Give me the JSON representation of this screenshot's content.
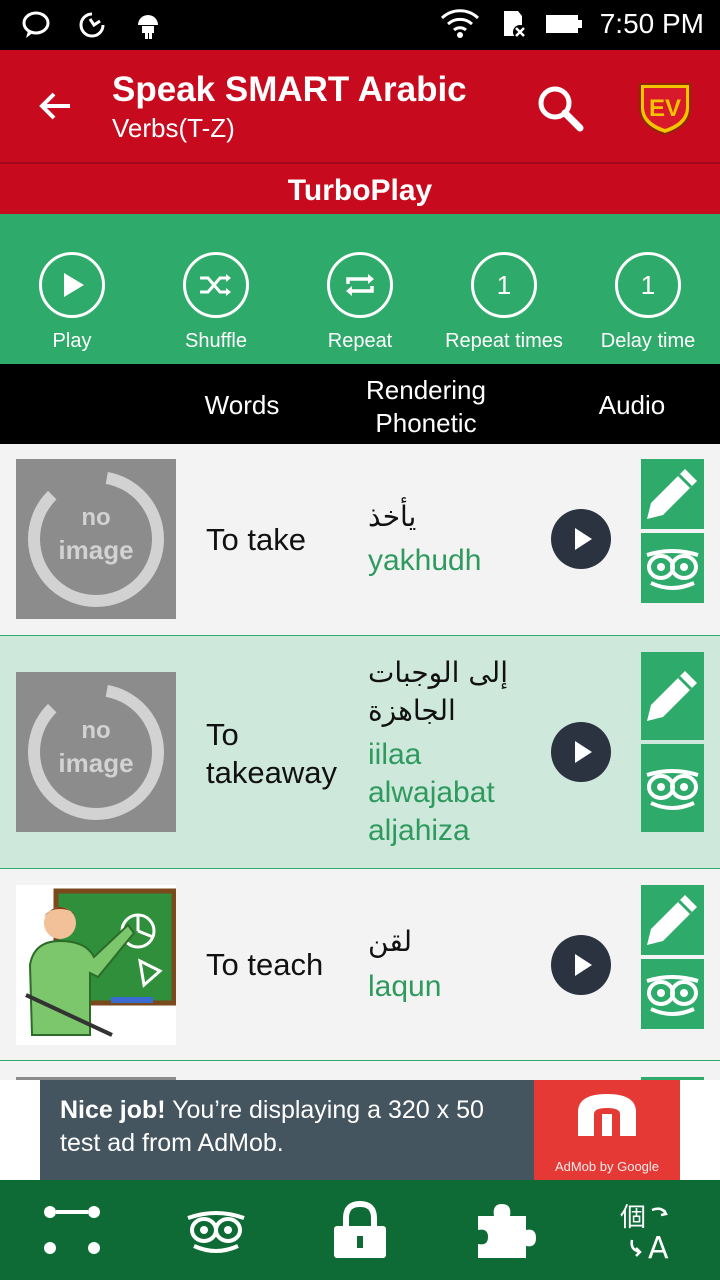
{
  "status_bar": {
    "time": "7:50 PM"
  },
  "app_bar": {
    "title": "Speak SMART Arabic",
    "subtitle": "Verbs(T-Z)",
    "logo_text": "EV"
  },
  "turbo": {
    "label": "TurboPlay"
  },
  "controls": {
    "play": {
      "label": "Play"
    },
    "shuffle": {
      "label": "Shuffle"
    },
    "repeat": {
      "label": "Repeat"
    },
    "repeat_times": {
      "label": "Repeat times",
      "value": "1"
    },
    "delay_time": {
      "label": "Delay time",
      "value": "1"
    }
  },
  "columns": {
    "words": "Words",
    "rendering_line1": "Rendering",
    "rendering_line2": "Phonetic",
    "audio": "Audio"
  },
  "placeholder": {
    "line1": "no",
    "line2": "image"
  },
  "rows": [
    {
      "word": "To take",
      "arabic": "يأخذ",
      "phonetic": "yakhudh"
    },
    {
      "word_line1": "To",
      "word_line2": "takeaway",
      "arabic_line1": "إلى الوجبات",
      "arabic_line2": "الجاهزة",
      "phonetic_line1": "iilaa",
      "phonetic_line2": "alwajabat",
      "phonetic_line3": "aljahiza"
    },
    {
      "word": "To teach",
      "arabic": "لقن",
      "phonetic": "laqun"
    }
  ],
  "ad": {
    "bold": "Nice job!",
    "text": " You’re displaying a 320 x 50 test ad from AdMob.",
    "brand": "AdMob by Google"
  },
  "colors": {
    "primary_red": "#c80a1e",
    "green": "#2eaa6a",
    "dark_green": "#0f6b36",
    "phonetic_green": "#2e9a5e"
  }
}
